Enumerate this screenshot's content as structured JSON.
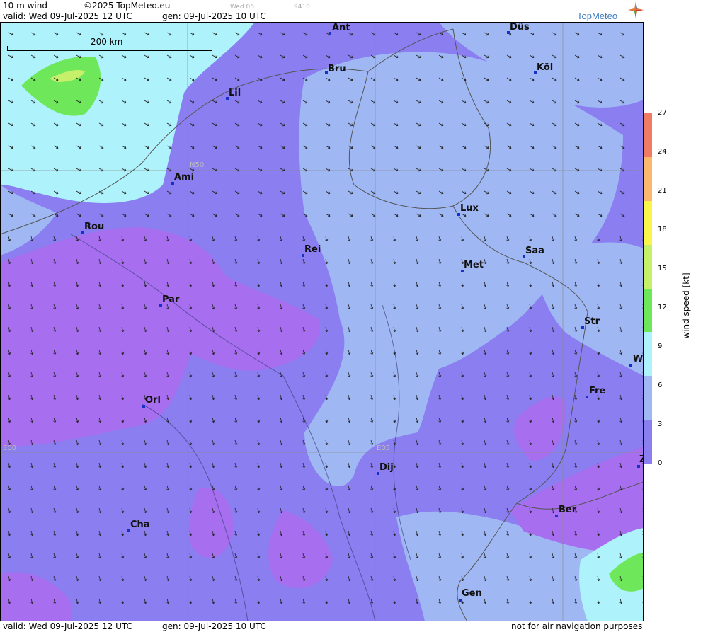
{
  "header": {
    "field": "10 m wind",
    "copyright": "©2025 TopMeteo.eu",
    "day_tag": "Wed 06",
    "code_tag": "9410",
    "valid_text": "valid:  Wed  09-Jul-2025  12 UTC",
    "gen_text": "gen: 09-Jul-2025 10 UTC",
    "logo": "TopMeteo",
    "logo_icon": "compass-star-icon"
  },
  "footer": {
    "valid_text": "valid:  Wed  09-Jul-2025  12 UTC",
    "gen_text": "gen: 09-Jul-2025 10 UTC",
    "disclaimer": "not for air navigation purposes"
  },
  "scale_bar": {
    "label": "200 km"
  },
  "grid_labels": {
    "n50": "N50",
    "e00": "E00",
    "e05": "E05"
  },
  "cities": [
    {
      "name": "Ant"
    },
    {
      "name": "Düs"
    },
    {
      "name": "Bru"
    },
    {
      "name": "Köl"
    },
    {
      "name": "Lil"
    },
    {
      "name": "Ami"
    },
    {
      "name": "Rou"
    },
    {
      "name": "Lux"
    },
    {
      "name": "Rei"
    },
    {
      "name": "Saa"
    },
    {
      "name": "Met"
    },
    {
      "name": "Par"
    },
    {
      "name": "Str"
    },
    {
      "name": "W"
    },
    {
      "name": "Fre"
    },
    {
      "name": "Orl"
    },
    {
      "name": "Dij"
    },
    {
      "name": "Z"
    },
    {
      "name": "Ber"
    },
    {
      "name": "Cha"
    },
    {
      "name": "Gen"
    }
  ],
  "legend": {
    "title": "wind  speed  [kt]",
    "ticks": [
      "27",
      "24",
      "21",
      "18",
      "15",
      "12",
      "9",
      "6",
      "3",
      "0"
    ],
    "colors": [
      "#8a7ef0",
      "#9fb8f4",
      "#aef2fb",
      "#6ee85a",
      "#c6ef6a",
      "#f9f54a",
      "#f9b86c",
      "#f07b63"
    ]
  }
}
